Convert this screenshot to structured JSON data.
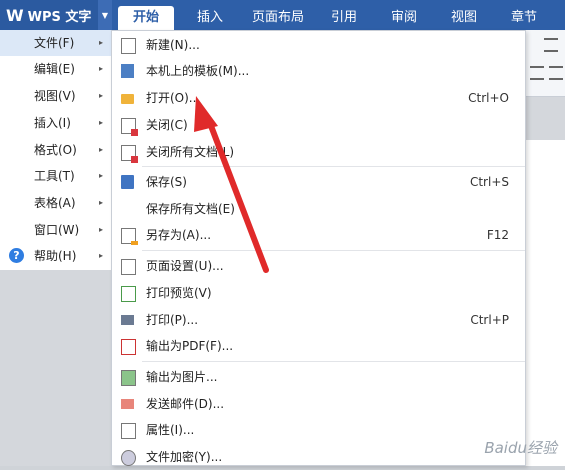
{
  "app": {
    "logo_glyph": "W",
    "title": "WPS 文字",
    "dropdown_glyph": "▼"
  },
  "tabs": [
    {
      "label": "开始"
    },
    {
      "label": "插入"
    },
    {
      "label": "页面布局"
    },
    {
      "label": "引用"
    },
    {
      "label": "审阅"
    },
    {
      "label": "视图"
    },
    {
      "label": "章节"
    }
  ],
  "left_menu": [
    {
      "label": "文件(F)"
    },
    {
      "label": "编辑(E)"
    },
    {
      "label": "视图(V)"
    },
    {
      "label": "插入(I)"
    },
    {
      "label": "格式(O)"
    },
    {
      "label": "工具(T)"
    },
    {
      "label": "表格(A)"
    },
    {
      "label": "窗口(W)"
    },
    {
      "label": "帮助(H)"
    }
  ],
  "submenu_arrow": "▸",
  "help_glyph": "?",
  "file_menu": [
    {
      "label": "新建(N)...",
      "shortcut": "",
      "icon": "new-document-icon"
    },
    {
      "label": "本机上的模板(M)...",
      "shortcut": "",
      "icon": "template-icon"
    },
    {
      "label": "打开(O)...",
      "shortcut": "Ctrl+O",
      "icon": "open-folder-icon"
    },
    {
      "label": "关闭(C)",
      "shortcut": "",
      "icon": "close-document-icon"
    },
    {
      "label": "关闭所有文档(L)",
      "shortcut": "",
      "icon": "close-all-icon"
    },
    {
      "label": "保存(S)",
      "shortcut": "Ctrl+S",
      "icon": "save-icon"
    },
    {
      "label": "保存所有文档(E)",
      "shortcut": "",
      "icon": ""
    },
    {
      "label": "另存为(A)...",
      "shortcut": "F12",
      "icon": "save-as-icon"
    },
    {
      "label": "页面设置(U)...",
      "shortcut": "",
      "icon": "page-setup-icon"
    },
    {
      "label": "打印预览(V)",
      "shortcut": "",
      "icon": "print-preview-icon"
    },
    {
      "label": "打印(P)...",
      "shortcut": "Ctrl+P",
      "icon": "printer-icon"
    },
    {
      "label": "输出为PDF(F)...",
      "shortcut": "",
      "icon": "pdf-icon"
    },
    {
      "label": "输出为图片...",
      "shortcut": "",
      "icon": "image-icon"
    },
    {
      "label": "发送邮件(D)...",
      "shortcut": "",
      "icon": "mail-icon"
    },
    {
      "label": "属性(I)...",
      "shortcut": "",
      "icon": "properties-icon"
    },
    {
      "label": "文件加密(Y)...",
      "shortcut": "",
      "icon": "encrypt-icon"
    }
  ],
  "watermark": "Baidu经验",
  "colors": {
    "ribbon_blue": "#2e5fa8",
    "arrow_red": "#e02a2a",
    "hover_bg": "#dce8f7"
  }
}
